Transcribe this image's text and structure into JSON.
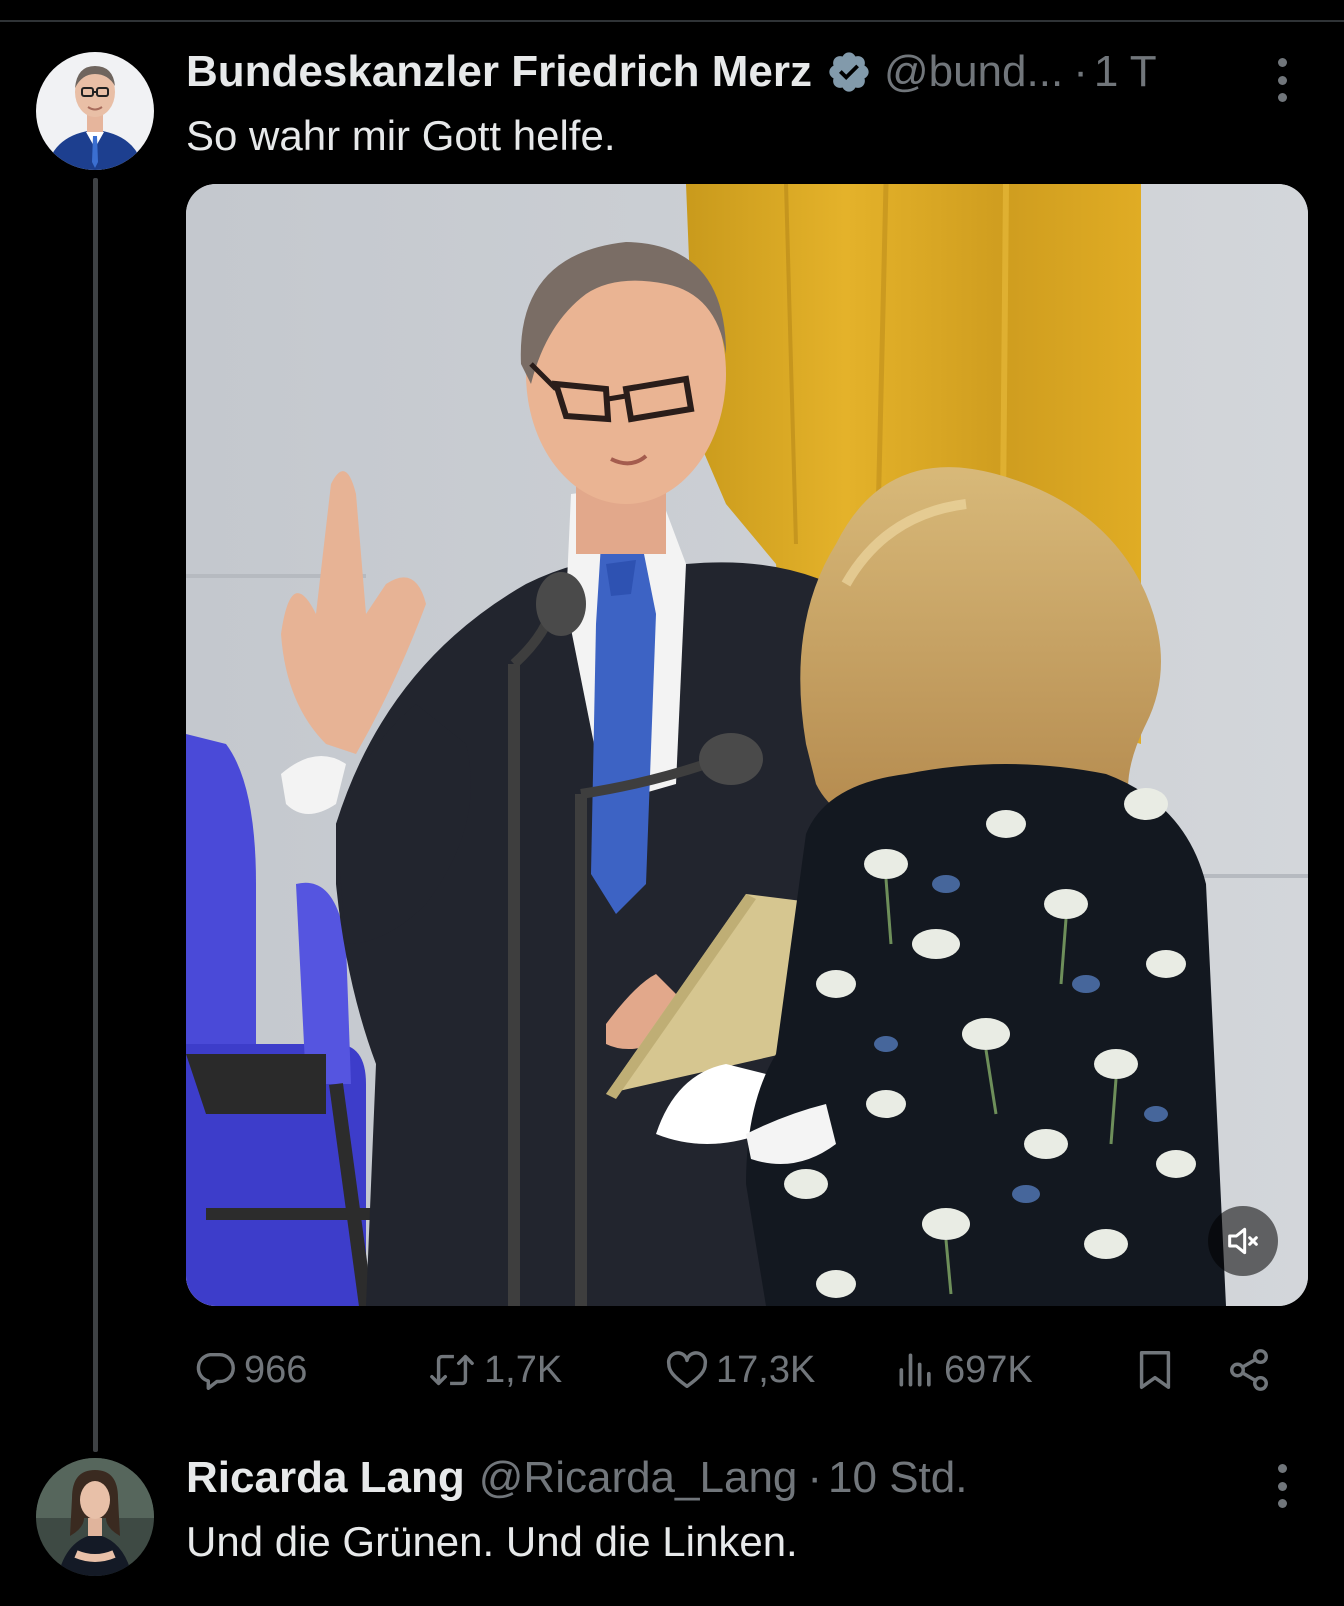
{
  "tweet": {
    "author_name": "Bundeskanzler Friedrich Merz",
    "handle": "@bund...",
    "separator": "·",
    "time": "1 T",
    "text": "So wahr mir Gott helfe.",
    "verified_icon": "verified-badge-icon",
    "media": {
      "type": "video",
      "mute_icon": "speaker-muted-icon"
    },
    "stats": {
      "replies": "966",
      "reposts": "1,7K",
      "likes": "17,3K",
      "views": "697K"
    },
    "action_icons": [
      "reply-icon",
      "repost-icon",
      "like-icon",
      "views-icon",
      "bookmark-icon",
      "share-icon"
    ]
  },
  "reply": {
    "author_name": "Ricarda Lang",
    "handle": "@Ricarda_Lang",
    "separator": "·",
    "time": "10 Std.",
    "text": "Und die Grünen. Und die Linken."
  },
  "colors": {
    "background": "#000000",
    "text_primary": "#e7e9ea",
    "text_secondary": "#71767b",
    "thread_line": "#3e4144",
    "verified": "#829aab"
  }
}
